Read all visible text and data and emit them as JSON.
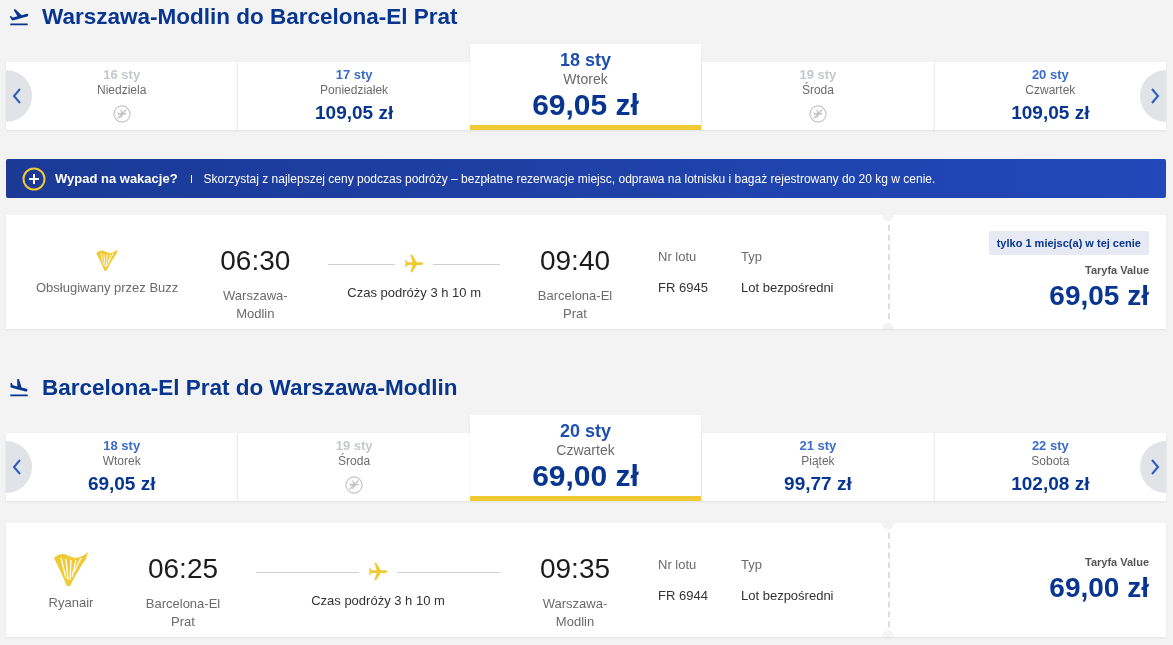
{
  "sections": [
    {
      "kind": "outbound",
      "title": "Warszawa-Modlin do Barcelona-El Prat",
      "dates": [
        {
          "date": "16 sty",
          "weekday": "Niedziela",
          "available": false,
          "selected": false
        },
        {
          "date": "17 sty",
          "weekday": "Poniedziałek",
          "price": "109,05 zł",
          "available": true,
          "selected": false
        },
        {
          "date": "18 sty",
          "weekday": "Wtorek",
          "price": "69,05 zł",
          "available": true,
          "selected": true
        },
        {
          "date": "19 sty",
          "weekday": "Środa",
          "available": false,
          "selected": false
        },
        {
          "date": "20 sty",
          "weekday": "Czwartek",
          "price": "109,05 zł",
          "available": true,
          "selected": false
        }
      ],
      "promo": {
        "title": "Wypad na wakacje?",
        "text": "Skorzystaj z najlepszej ceny podczas podróży – bezpłatne rezerwacje miejsc, odprawa na lotnisku i bagaż rejestrowany do 20 kg w cenie."
      },
      "flight": {
        "operator": {
          "kind": "partner",
          "label": "Obsługiwany przez Buzz"
        },
        "departure_time": "06:30",
        "departure_airport": "Warszawa-Modlin",
        "duration": "Czas podróży 3 h 10 m",
        "arrival_time": "09:40",
        "arrival_airport": "Barcelona-El Prat",
        "flight_number_label": "Nr lotu",
        "flight_number": "FR 6945",
        "type_label": "Typ",
        "type": "Lot bezpośredni",
        "badge": "tylko 1 miejsc(a) w tej cenie",
        "fare": "Taryfa Value",
        "price": "69,05 zł"
      }
    },
    {
      "kind": "inbound",
      "title": "Barcelona-El Prat do Warszawa-Modlin",
      "dates": [
        {
          "date": "18 sty",
          "weekday": "Wtorek",
          "price": "69,05 zł",
          "available": true,
          "selected": false
        },
        {
          "date": "19 sty",
          "weekday": "Środa",
          "available": false,
          "selected": false
        },
        {
          "date": "20 sty",
          "weekday": "Czwartek",
          "price": "69,00 zł",
          "available": true,
          "selected": true
        },
        {
          "date": "21 sty",
          "weekday": "Piątek",
          "price": "99,77 zł",
          "available": true,
          "selected": false
        },
        {
          "date": "22 sty",
          "weekday": "Sobota",
          "price": "102,08 zł",
          "available": true,
          "selected": false
        }
      ],
      "flight": {
        "operator": {
          "kind": "own",
          "label": "Ryanair"
        },
        "departure_time": "06:25",
        "departure_airport": "Barcelona-El Prat",
        "duration": "Czas podróży 3 h 10 m",
        "arrival_time": "09:35",
        "arrival_airport": "Warszawa-Modlin",
        "flight_number_label": "Nr lotu",
        "flight_number": "FR 6944",
        "type_label": "Typ",
        "type": "Lot bezpośredni",
        "fare": "Taryfa Value",
        "price": "69,00 zł"
      }
    }
  ]
}
